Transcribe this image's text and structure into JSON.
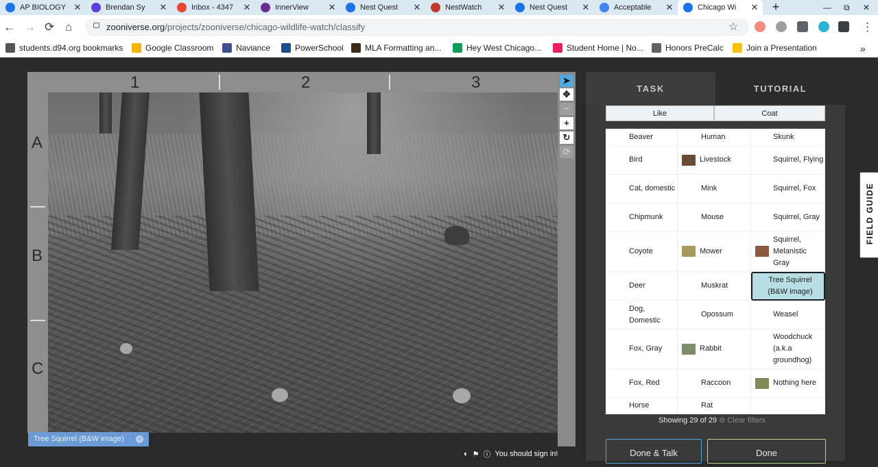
{
  "tabs": [
    {
      "title": "AP BIOLOGY",
      "color": "#1a73e8"
    },
    {
      "title": "Brendan Sy",
      "color": "#5b3fd6"
    },
    {
      "title": "Inbox - 4347",
      "color": "#ea4335"
    },
    {
      "title": "InnerView",
      "color": "#6b2c91"
    },
    {
      "title": "Nest Quest",
      "color": "#1a73e8"
    },
    {
      "title": "NestWatch",
      "color": "#c0392b"
    },
    {
      "title": "Nest Quest",
      "color": "#1a73e8"
    },
    {
      "title": "Acceptable",
      "color": "#4285f4"
    },
    {
      "title": "Chicago Wi",
      "color": "#1a73e8"
    }
  ],
  "tab_close": "✕",
  "new_tab": "+",
  "window": {
    "min": "—",
    "max": "⧉",
    "close": "✕"
  },
  "nav": {
    "back": "←",
    "forward": "→",
    "reload": "⟳",
    "home": "⌂",
    "star": "☆",
    "menu": "⋮"
  },
  "url": {
    "domain": "zooniverse.org",
    "path": "/projects/zooniverse/chicago-wildlife-watch/classify"
  },
  "bookmarks": [
    {
      "label": "students.d94.org bookmarks",
      "color": "#555"
    },
    {
      "label": "Google Classroom",
      "color": "#f4b400"
    },
    {
      "label": "Naviance",
      "color": "#3d4f8f"
    },
    {
      "label": "PowerSchool",
      "color": "#1f4d8c"
    },
    {
      "label": "MLA Formatting an...",
      "color": "#3b2a1a"
    },
    {
      "label": "Hey West Chicago...",
      "color": "#0f9d58"
    },
    {
      "label": "Student Home | No...",
      "color": "#e91e63"
    },
    {
      "label": "Honors PreCalc",
      "color": "#5f6368"
    },
    {
      "label": "Join a Presentation",
      "color": "#f4c20d"
    }
  ],
  "bookmarks_more": "»",
  "grid_cols": [
    "1",
    "2",
    "3"
  ],
  "grid_rows": [
    "A",
    "B",
    "C"
  ],
  "image_tag": "Tree Squirrel (B&W image)",
  "image_tag_x": "×",
  "tools": {
    "pointer": "➤",
    "move": "✥",
    "zoom_out": "−",
    "zoom_in": "+",
    "rotate": "↻",
    "reset": "⟳"
  },
  "footer": {
    "contrast": "◐",
    "flag": "⚑",
    "info": "ⓘ",
    "signin": "You should sign in!"
  },
  "panel": {
    "tab_task": "TASK",
    "tab_tutorial": "TUTORIAL",
    "filter_like": "Like",
    "filter_coat": "Coat",
    "showing": "Showing 29 of 29",
    "clear": "⊘ Clear filters",
    "done_talk": "Done & Talk",
    "done": "Done"
  },
  "choices": [
    [
      "Beaver",
      "Human",
      "Skunk"
    ],
    [
      "Bird",
      "Livestock",
      "Squirrel, Flying"
    ],
    [
      "Cat, domestic",
      "Mink",
      "Squirrel, Fox"
    ],
    [
      "Chipmunk",
      "Mouse",
      "Squirrel, Gray"
    ],
    [
      "Coyote",
      "Mower",
      "Squirrel, Melanistic Gray"
    ],
    [
      "Deer",
      "Muskrat",
      "Tree Squirrel (B&W image)"
    ],
    [
      "Dog, Domestic",
      "Opossum",
      "Weasel"
    ],
    [
      "Fox, Gray",
      "Rabbit",
      "Woodchuck (a.k.a groundhog)"
    ],
    [
      "Fox, Red",
      "Raccoon",
      "Nothing here"
    ],
    [
      "Horse",
      "Rat",
      ""
    ]
  ],
  "field_guide": "FIELD GUIDE"
}
